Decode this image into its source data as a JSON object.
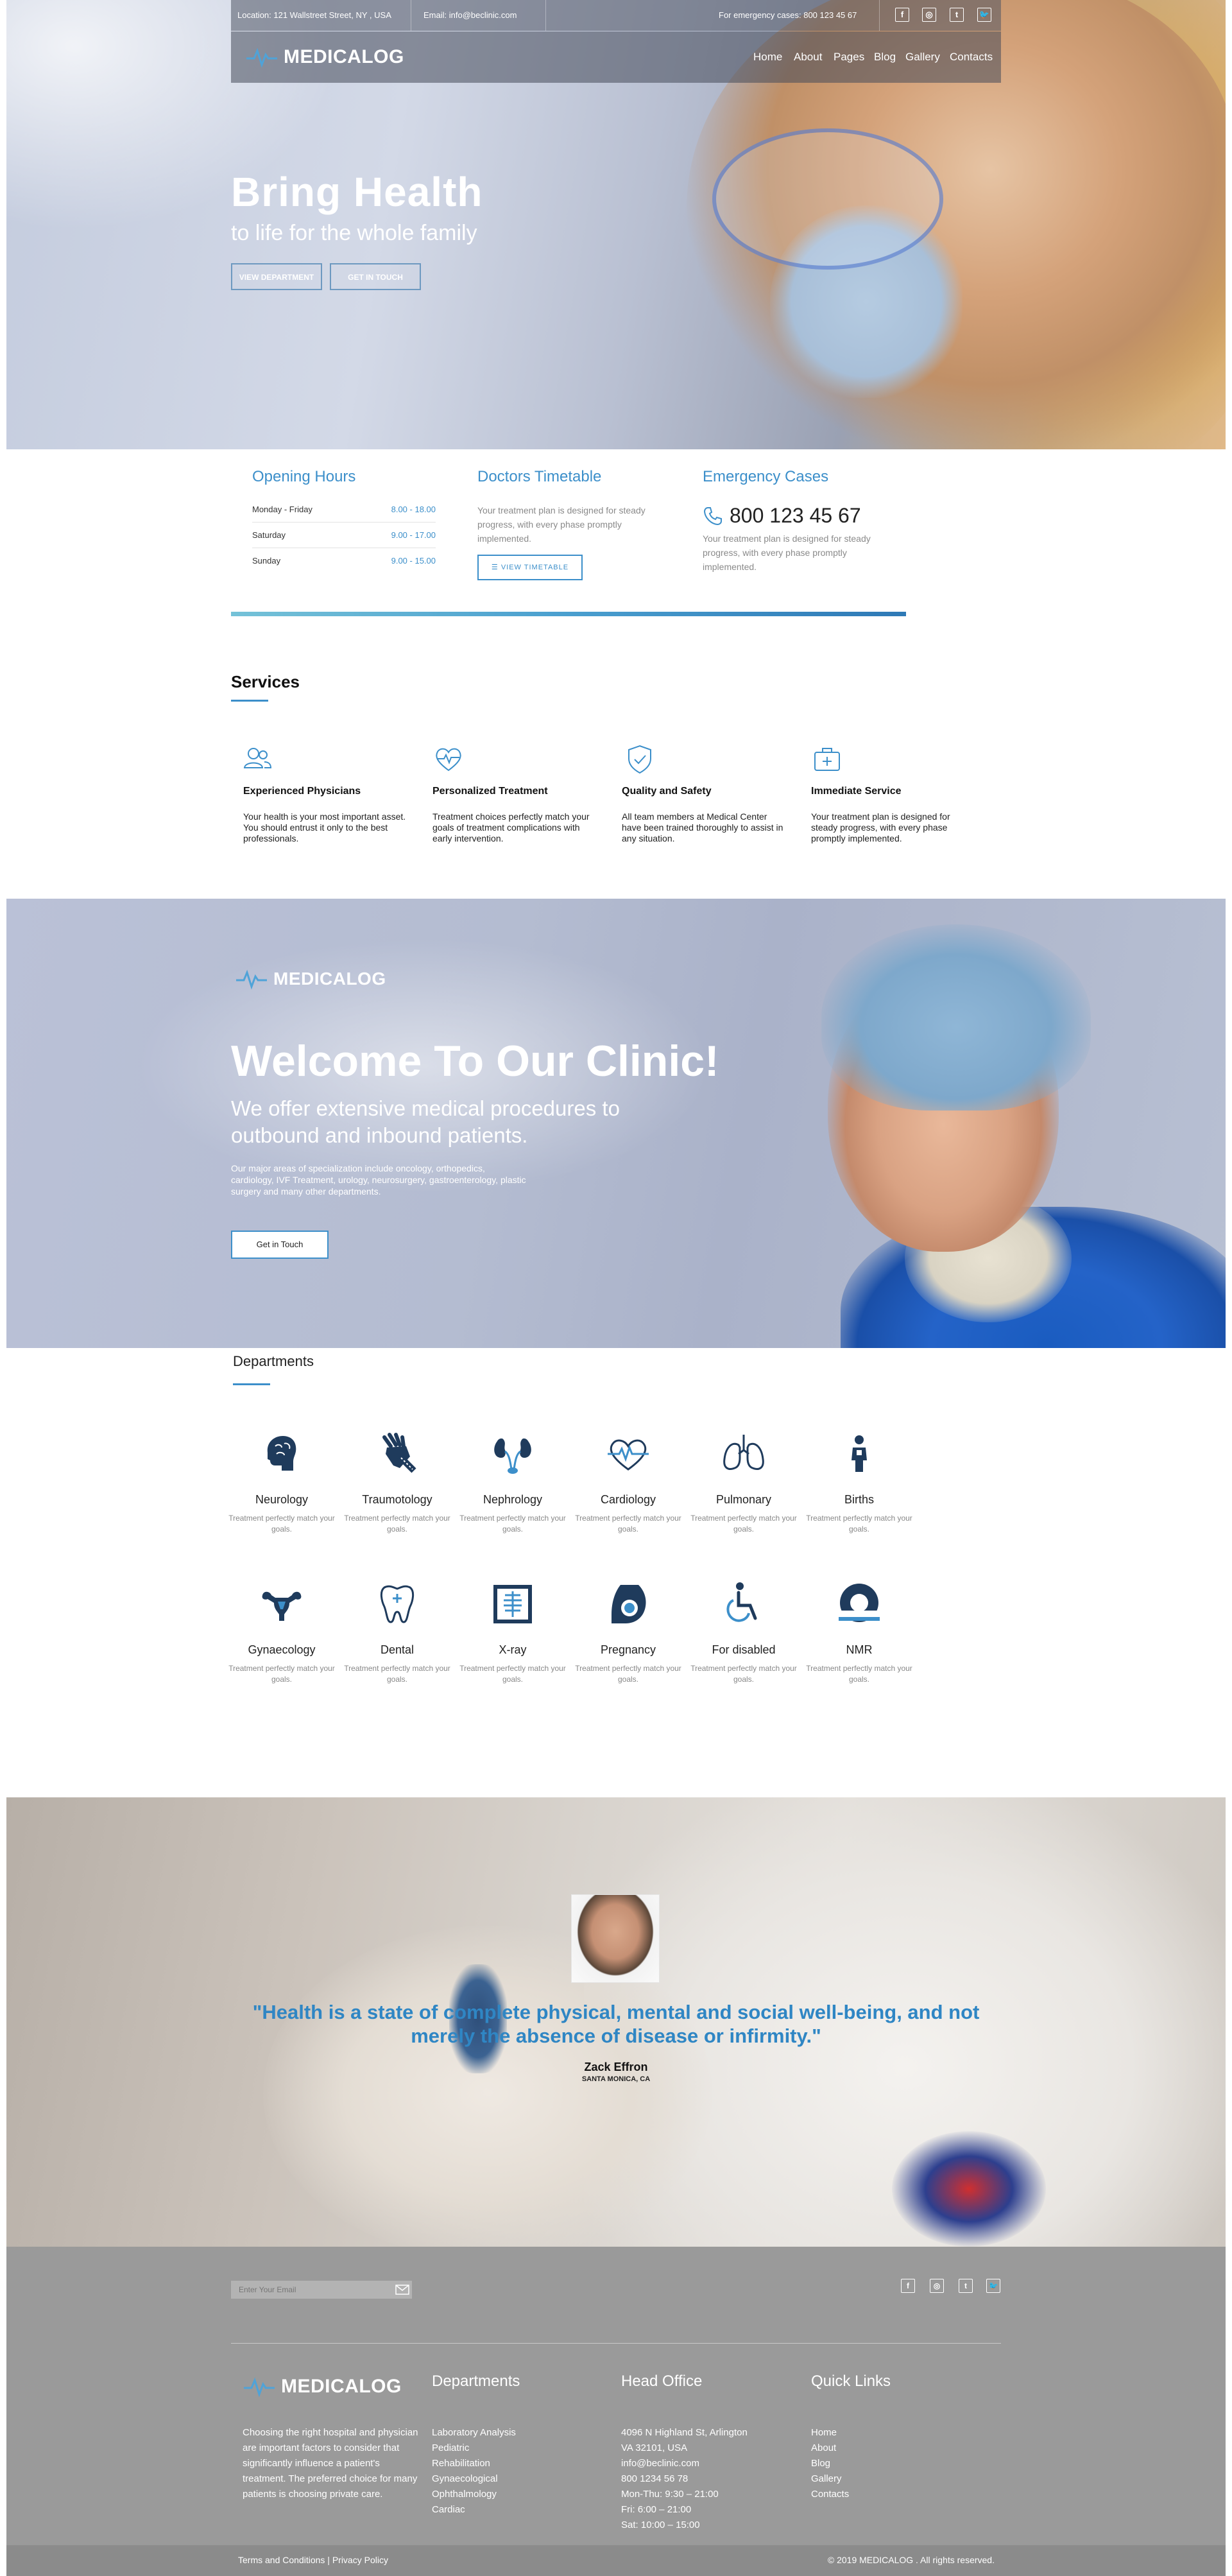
{
  "topbar": {
    "location": "Location: 121 Wallstreet Street, NY , USA",
    "email": "Email: info@beclinic.com",
    "emergency": "For emergency cases: 800 123 45 67",
    "social": [
      "f",
      "ig",
      "t",
      "tw"
    ]
  },
  "brand": {
    "name": "MEDICALOG"
  },
  "nav": {
    "items": [
      "Home",
      "About",
      "Pages",
      "Blog",
      "Gallery",
      "Contacts"
    ]
  },
  "hero": {
    "title": "Bring Health",
    "subtitle": "to life for the whole family",
    "btn_department": "view department",
    "btn_contact": "get in touch"
  },
  "info": {
    "opening_title": "Opening Hours",
    "hours": [
      {
        "day": "Monday - Friday",
        "time": "8.00 - 18.00"
      },
      {
        "day": "Saturday",
        "time": "9.00 - 17.00"
      },
      {
        "day": "Sunday",
        "time": "9.00 - 15.00"
      }
    ],
    "timetable_title": "Doctors Timetable",
    "timetable_text": "Your treatment plan is designed for steady progress, with every phase promptly implemented.",
    "timetable_btn": "VIEW TIMETABLE",
    "emergency_title": "Emergency Cases",
    "emergency_phone": "800 123 45 67",
    "emergency_text": "Your treatment plan is designed for steady progress, with every phase promptly implemented."
  },
  "services": {
    "title": "Services",
    "items": [
      {
        "icon": "users-icon",
        "title": "Experienced Physicians",
        "text": "Your health is your most important asset. You should entrust it only to the best professionals."
      },
      {
        "icon": "heart-pulse-icon",
        "title": "Personalized Treatment",
        "text": "Treatment choices perfectly match your goals of treatment complications with early intervention."
      },
      {
        "icon": "shield-check-icon",
        "title": "Quality and Safety",
        "text": "All team members at Medical Center have been trained thoroughly to assist in any situation."
      },
      {
        "icon": "first-aid-kit-icon",
        "title": "Immediate Service",
        "text": "Your treatment plan is designed for steady progress, with every phase promptly implemented."
      }
    ]
  },
  "welcome": {
    "title": "Welcome To Our Clinic!",
    "subtitle_line1": "We offer extensive medical procedures to",
    "subtitle_line2": "outbound and inbound patients.",
    "text": "Our major areas of specialization include oncology, orthopedics, cardiology, IVF Treatment, urology, neurosurgery, gastroenterology, plastic surgery and many other departments.",
    "button": "Get in Touch"
  },
  "departments": {
    "title": "Departments",
    "desc": "Treatment perfectly match your goals.",
    "items": [
      {
        "name": "Neurology",
        "icon": "brain-icon"
      },
      {
        "name": "Traumotology",
        "icon": "bandaged-hand-icon"
      },
      {
        "name": "Nephrology",
        "icon": "kidneys-icon"
      },
      {
        "name": "Cardiology",
        "icon": "heart-pulse-icon"
      },
      {
        "name": "Pulmonary",
        "icon": "lungs-icon"
      },
      {
        "name": "Births",
        "icon": "baby-icon"
      },
      {
        "name": "Gynaecology",
        "icon": "uterus-icon"
      },
      {
        "name": "Dental",
        "icon": "tooth-icon"
      },
      {
        "name": "X-ray",
        "icon": "xray-icon"
      },
      {
        "name": "Pregnancy",
        "icon": "pregnancy-icon"
      },
      {
        "name": "For disabled",
        "icon": "wheelchair-icon"
      },
      {
        "name": "NMR",
        "icon": "mri-scanner-icon"
      }
    ]
  },
  "testimonial": {
    "quote": "\"Health is a state of complete physical, mental and social well-being, and not merely the absence of disease or infirmity.\"",
    "author": "Zack Effron",
    "location": "SANTA MONICA, CA"
  },
  "footer": {
    "email_placeholder": "Enter Your Email",
    "brand": "MEDICALOG",
    "description": "Choosing the right hospital and physician are important factors to consider that significantly influence a patient's treatment. The preferred choice for many patients is choosing private care.",
    "departments_title": "Departments",
    "departments": [
      "Laboratory Analysis",
      "Pediatric",
      "Rehabilitation",
      "Gynaecological",
      "Ophthalmology",
      "Cardiac"
    ],
    "office_title": "Head Office",
    "office": [
      "4096 N Highland St, Arlington",
      "VA 32101, USA",
      "info@beclinic.com",
      "800 1234 56 78",
      "Mon-Thu: 9:30 – 21:00",
      "Fri: 6:00 – 21:00",
      "Sat: 10:00 – 15:00"
    ],
    "links_title": "Quick Links",
    "links": [
      "Home",
      "About",
      "Blog",
      "Gallery",
      "Contacts"
    ],
    "legal": "Terms and Conditions | Privacy Policy",
    "copyright": "© 2019 MEDICALOG . All rights reserved."
  },
  "colors": {
    "accent": "#3c8fca",
    "footer": "#9a9a9a",
    "bottom_bar": "#8b8b8b"
  }
}
